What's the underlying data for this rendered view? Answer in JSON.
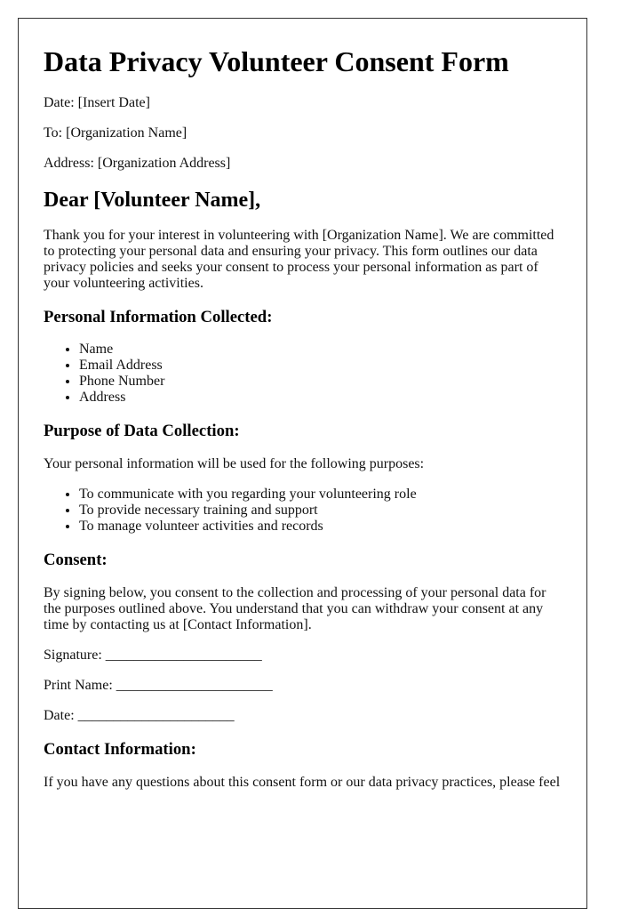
{
  "document": {
    "title": "Data Privacy Volunteer Consent Form",
    "meta": [
      {
        "label": "Date:",
        "value": "[Insert Date]"
      },
      {
        "label": "To:",
        "value": "[Organization Name]"
      },
      {
        "label": "Address:",
        "value": "[Organization Address]"
      }
    ],
    "salutation": "Dear [Volunteer Name],",
    "intro": "Thank you for your interest in volunteering with [Organization Name]. We are committed to protecting your personal data and ensuring your privacy. This form outlines our data privacy policies and seeks your consent to process your personal information as part of your volunteering activities.",
    "sections": {
      "personal_info": {
        "heading": "Personal Information Collected:",
        "items": [
          "Name",
          "Email Address",
          "Phone Number",
          "Address"
        ]
      },
      "purpose": {
        "heading": "Purpose of Data Collection:",
        "text": "Your personal information will be used for the following purposes:",
        "items": [
          "To communicate with you regarding your volunteering role",
          "To provide necessary training and support",
          "To manage volunteer activities and records"
        ]
      },
      "consent": {
        "heading": "Consent:",
        "text": "By signing below, you consent to the collection and processing of your personal data for the purposes outlined above. You understand that you can withdraw your consent at any time by contacting us at [Contact Information].",
        "fields": [
          {
            "label": "Signature:",
            "blank": "______________________"
          },
          {
            "label": "Print Name:",
            "blank": "______________________"
          },
          {
            "label": "Date:",
            "blank": "______________________"
          }
        ]
      },
      "contact": {
        "heading": "Contact Information:",
        "text": "If you have any questions about this consent form or our data privacy practices, please feel"
      }
    }
  }
}
